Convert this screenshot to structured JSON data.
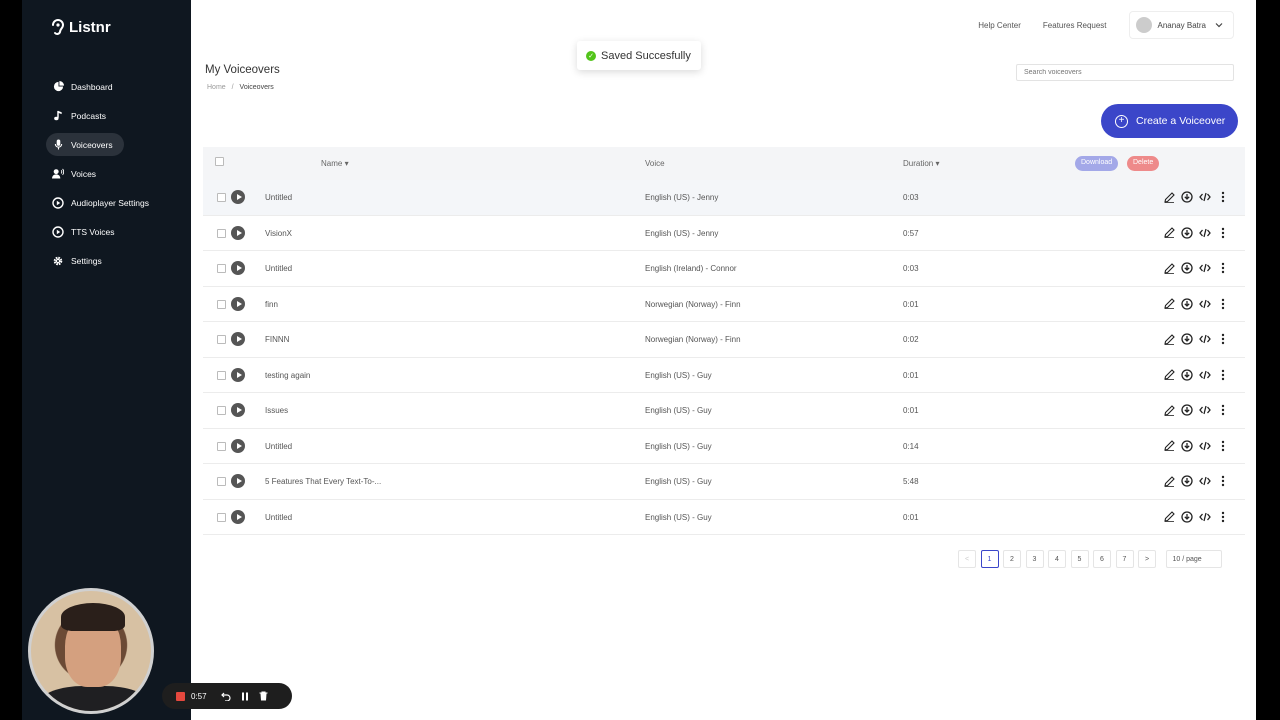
{
  "app": {
    "name": "Listnr"
  },
  "nav": [
    {
      "label": "Dashboard",
      "icon": "pie-chart-icon"
    },
    {
      "label": "Podcasts",
      "icon": "music-note-icon"
    },
    {
      "label": "Voiceovers",
      "icon": "microphone-icon",
      "active": true
    },
    {
      "label": "Voices",
      "icon": "voice-user-icon"
    },
    {
      "label": "Audioplayer Settings",
      "icon": "play-circle-icon"
    },
    {
      "label": "TTS Voices",
      "icon": "play-circle-icon"
    },
    {
      "label": "Settings",
      "icon": "gear-icon"
    }
  ],
  "topbar": {
    "help": "Help Center",
    "features": "Features Request",
    "user": "Ananay Batra"
  },
  "toast": {
    "text": "Saved Succesfully"
  },
  "page": {
    "title": "My Voiceovers",
    "breadcrumb_home": "Home",
    "breadcrumb_sep": "/",
    "breadcrumb_current": "Voiceovers"
  },
  "search": {
    "placeholder": "Search voiceovers"
  },
  "create_label": "Create a Voiceover",
  "table": {
    "headers": {
      "name": "Name",
      "voice": "Voice",
      "duration": "Duration"
    },
    "download_label": "Download",
    "delete_label": "Delete",
    "rows": [
      {
        "name": "Untitled",
        "voice": "English (US) - Jenny",
        "duration": "0:03"
      },
      {
        "name": "VisionX",
        "voice": "English (US) - Jenny",
        "duration": "0:57"
      },
      {
        "name": "Untitled",
        "voice": "English (Ireland) - Connor",
        "duration": "0:03"
      },
      {
        "name": "finn",
        "voice": "Norwegian (Norway) - Finn",
        "duration": "0:01"
      },
      {
        "name": "FINNN",
        "voice": "Norwegian (Norway) - Finn",
        "duration": "0:02"
      },
      {
        "name": "testing again",
        "voice": "English (US) - Guy",
        "duration": "0:01"
      },
      {
        "name": "Issues",
        "voice": "English (US) - Guy",
        "duration": "0:01"
      },
      {
        "name": "Untitled",
        "voice": "English (US) - Guy",
        "duration": "0:14"
      },
      {
        "name": "5 Features That Every Text-To-...",
        "voice": "English (US) - Guy",
        "duration": "5:48"
      },
      {
        "name": "Untitled",
        "voice": "English (US) - Guy",
        "duration": "0:01"
      }
    ]
  },
  "pagination": {
    "prev": "<",
    "pages": [
      "1",
      "2",
      "3",
      "4",
      "5",
      "6",
      "7"
    ],
    "current": "1",
    "next": ">",
    "page_size": "10 / page"
  },
  "recorder": {
    "time": "0:57"
  },
  "colors": {
    "sidebar": "#0f1720",
    "accent": "#3b46c9",
    "download": "#a3a8e8",
    "delete": "#ee8a8a",
    "success": "#52c41a",
    "chat": "#1b6fc4"
  }
}
